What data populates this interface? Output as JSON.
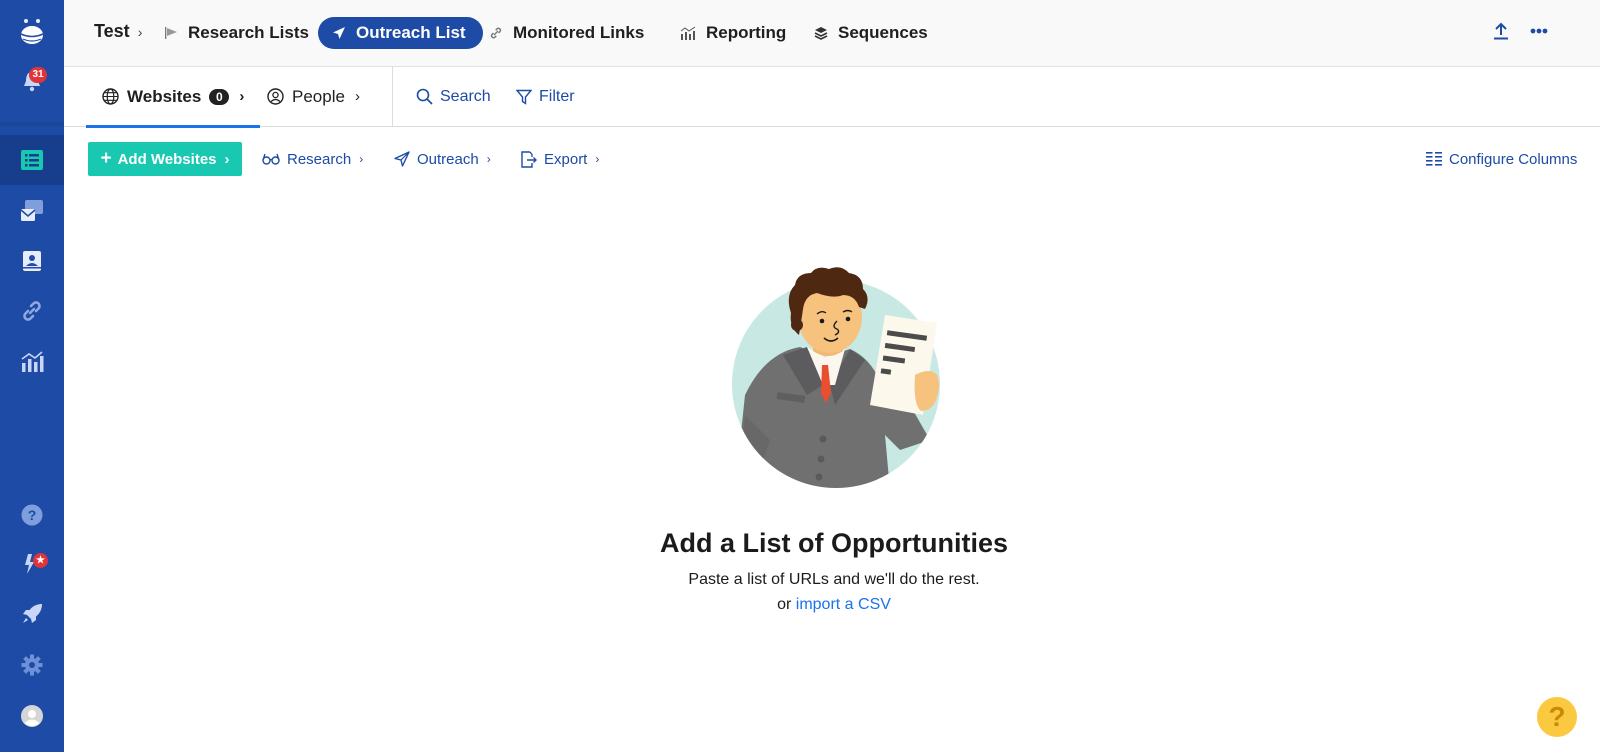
{
  "sidebar": {
    "notifications_count": "31",
    "items": [
      {
        "name": "logo"
      },
      {
        "name": "notifications"
      },
      {
        "name": "lists",
        "active": true
      },
      {
        "name": "inbox"
      },
      {
        "name": "contacts"
      },
      {
        "name": "links"
      },
      {
        "name": "reporting"
      },
      {
        "name": "help"
      },
      {
        "name": "whats-new"
      },
      {
        "name": "onboarding"
      },
      {
        "name": "settings"
      },
      {
        "name": "profile"
      }
    ]
  },
  "topnav": {
    "breadcrumb": "Test",
    "items": [
      {
        "label": "Research Lists",
        "icon": "flag-icon"
      },
      {
        "label": "Outreach List",
        "icon": "send-icon",
        "active": true
      },
      {
        "label": "Monitored Links",
        "icon": "link-icon"
      },
      {
        "label": "Reporting",
        "icon": "bar-chart-icon"
      },
      {
        "label": "Sequences",
        "icon": "layers-icon"
      }
    ]
  },
  "subtabs": {
    "websites": {
      "label": "Websites",
      "count": "0"
    },
    "people": {
      "label": "People"
    },
    "search": "Search",
    "filter": "Filter"
  },
  "toolbar": {
    "add_websites": "Add Websites",
    "research": "Research",
    "outreach": "Outreach",
    "export": "Export",
    "configure_columns": "Configure Columns"
  },
  "empty_state": {
    "title": "Add a List of Opportunities",
    "subtitle": "Paste a list of URLs and we'll do the rest.",
    "alt_prefix": "or",
    "alt_link": "import a CSV"
  },
  "help_fab": "?",
  "colors": {
    "sidebar": "#1d4ba6",
    "accent": "#1a73e8",
    "add_button": "#18c8b0",
    "badge": "#e0343a"
  }
}
